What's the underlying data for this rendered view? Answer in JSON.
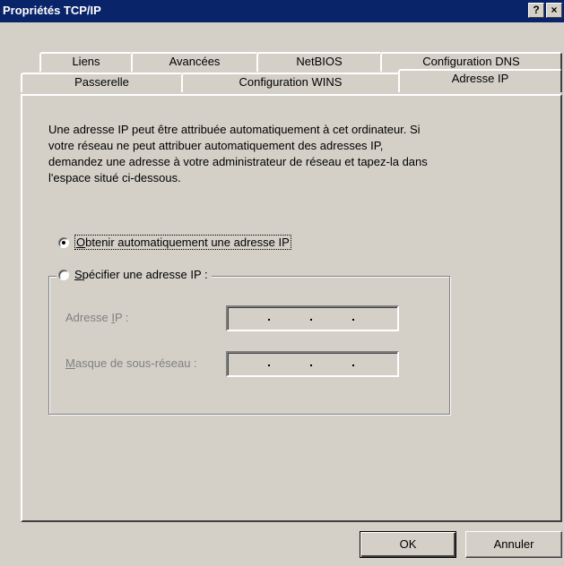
{
  "window": {
    "title": "Propriétés TCP/IP",
    "help_glyph": "?",
    "close_glyph": "×"
  },
  "tabs": {
    "row1": [
      "Liens",
      "Avancées",
      "NetBIOS",
      "Configuration DNS"
    ],
    "row2": [
      "Passerelle",
      "Configuration WINS",
      "Adresse IP"
    ],
    "selected": "Adresse IP"
  },
  "panel": {
    "description": "Une adresse IP peut être attribuée automatiquement à cet ordinateur. Si votre réseau ne peut attribuer automatiquement des adresses IP, demandez une adresse à votre administrateur de réseau et tapez-la dans l'espace situé ci-dessous.",
    "radio_auto": {
      "accel": "O",
      "rest": "btenir automatiquement une adresse IP",
      "checked": true
    },
    "radio_manual": {
      "accel": "S",
      "rest": "pécifier une adresse IP :",
      "checked": false
    },
    "field_ip": {
      "before": "Adresse ",
      "accel": "I",
      "after": "P :",
      "value": ""
    },
    "field_mask": {
      "before": "",
      "accel": "M",
      "after": "asque de sous-réseau :",
      "value": ""
    }
  },
  "buttons": {
    "ok": "OK",
    "cancel": "Annuler"
  },
  "colors": {
    "titlebar": "#0a246a",
    "face": "#d4d0c8",
    "disabled_text": "#808080"
  }
}
